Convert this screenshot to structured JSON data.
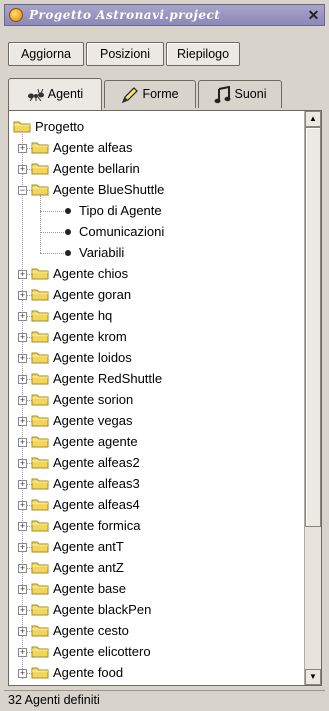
{
  "window": {
    "title": "Progetto Astronavi.project",
    "close_glyph": "✕"
  },
  "toolbar": {
    "buttons": [
      {
        "label": "Aggiorna"
      },
      {
        "label": "Posizioni"
      },
      {
        "label": "Riepilogo"
      }
    ]
  },
  "tabs": [
    {
      "label": "Agenti",
      "icon": "ant-icon",
      "active": true
    },
    {
      "label": "Forme",
      "icon": "pencil-icon",
      "active": false
    },
    {
      "label": "Suoni",
      "icon": "music-notes-icon",
      "active": false
    }
  ],
  "tree": {
    "root": "Progetto",
    "items": [
      {
        "label": "Agente alfeas",
        "expanded": false
      },
      {
        "label": "Agente bellarin",
        "expanded": false
      },
      {
        "label": "Agente BlueShuttle",
        "expanded": true,
        "children": [
          "Tipo di Agente",
          "Comunicazioni",
          "Variabili"
        ]
      },
      {
        "label": "Agente chios",
        "expanded": false
      },
      {
        "label": "Agente goran",
        "expanded": false
      },
      {
        "label": "Agente hq",
        "expanded": false
      },
      {
        "label": "Agente krom",
        "expanded": false
      },
      {
        "label": "Agente loidos",
        "expanded": false
      },
      {
        "label": "Agente RedShuttle",
        "expanded": false
      },
      {
        "label": "Agente sorion",
        "expanded": false
      },
      {
        "label": "Agente vegas",
        "expanded": false
      },
      {
        "label": "Agente agente",
        "expanded": false
      },
      {
        "label": "Agente alfeas2",
        "expanded": false
      },
      {
        "label": "Agente alfeas3",
        "expanded": false
      },
      {
        "label": "Agente alfeas4",
        "expanded": false
      },
      {
        "label": "Agente formica",
        "expanded": false
      },
      {
        "label": "Agente antT",
        "expanded": false
      },
      {
        "label": "Agente antZ",
        "expanded": false
      },
      {
        "label": "Agente base",
        "expanded": false
      },
      {
        "label": "Agente blackPen",
        "expanded": false
      },
      {
        "label": "Agente cesto",
        "expanded": false
      },
      {
        "label": "Agente elicottero",
        "expanded": false
      },
      {
        "label": "Agente food",
        "expanded": false
      }
    ]
  },
  "status": {
    "text": "32 Agenti definiti"
  }
}
